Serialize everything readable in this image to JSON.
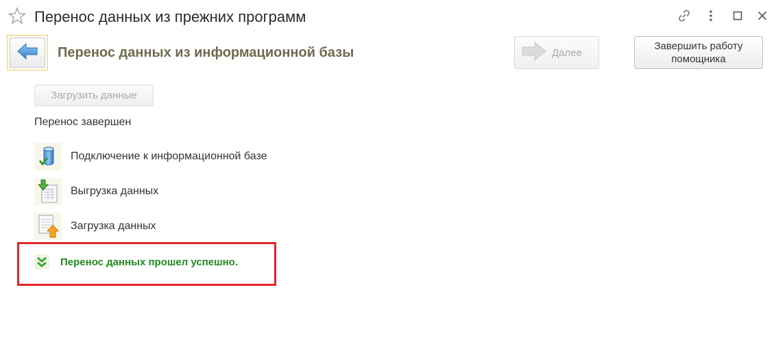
{
  "window": {
    "title": "Перенос данных из прежних программ"
  },
  "header": {
    "subtitle": "Перенос данных из информационной базы"
  },
  "toolbar": {
    "next_label": "Далее",
    "finish_label": "Завершить работу\nпомощника"
  },
  "main": {
    "load_button_label": "Загрузить данные",
    "status_text": "Перенос завершен",
    "steps": [
      {
        "label": "Подключение к информационной базе",
        "icon": "database-check-icon"
      },
      {
        "label": "Выгрузка данных",
        "icon": "export-data-icon"
      },
      {
        "label": "Загрузка данных",
        "icon": "import-data-icon"
      }
    ],
    "result_text": "Перенос данных прошел успешно."
  },
  "colors": {
    "highlight_border": "#e2232b",
    "success_text": "#1f8a1f",
    "subtitle": "#6e6a4e"
  }
}
